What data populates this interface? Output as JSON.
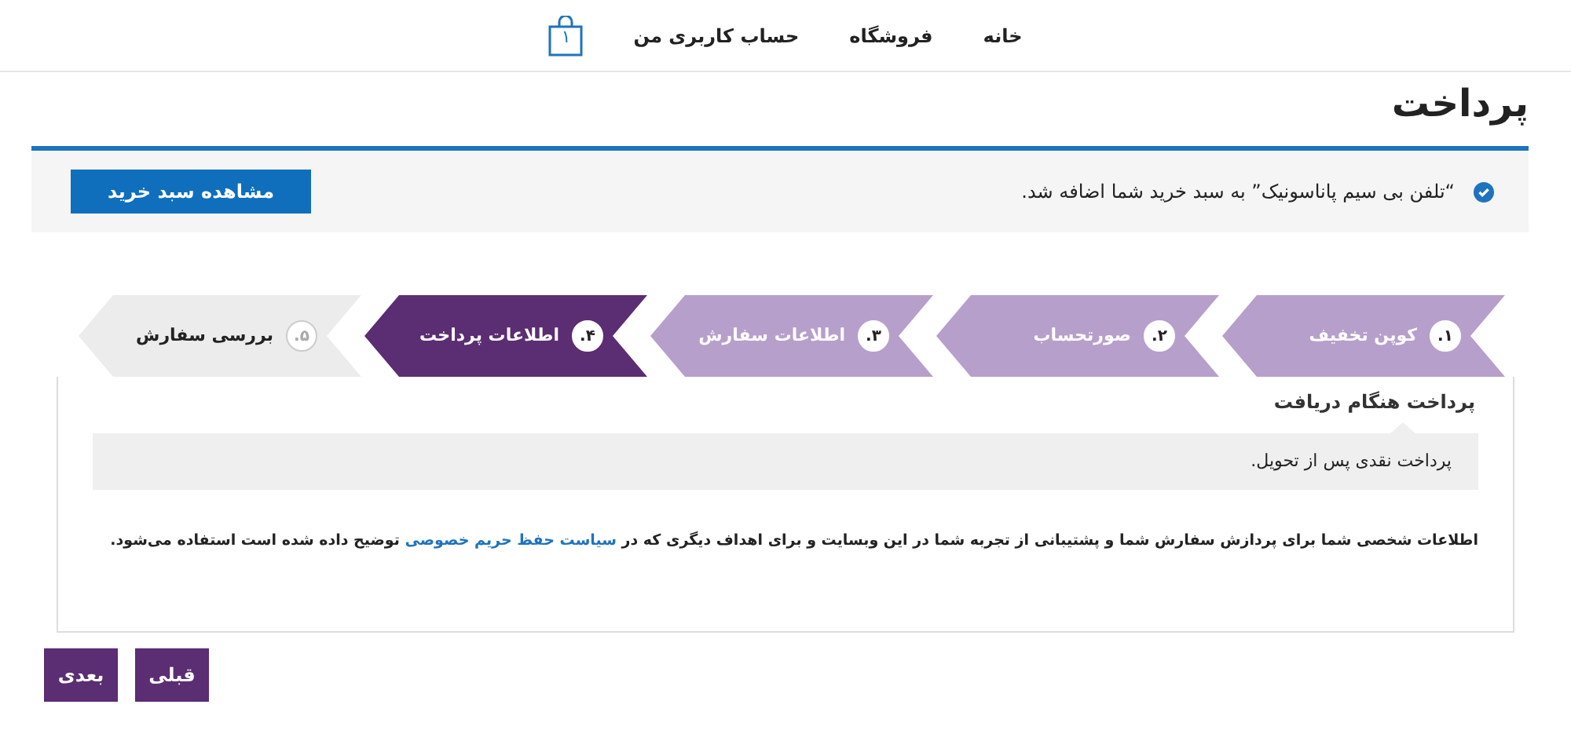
{
  "nav": {
    "items": [
      {
        "label": "خانه"
      },
      {
        "label": "فروشگاه"
      },
      {
        "label": "حساب کاربری من"
      }
    ],
    "cart_count": "۱"
  },
  "page_title": "پرداخت",
  "notice": {
    "message": "“تلفن بی سیم پاناسونیک” به سبد خرید شما اضافه شد.",
    "button": "مشاهده سبد خرید"
  },
  "steps": [
    {
      "number": "۱.",
      "label": "کوپن تخفیف",
      "selected": false
    },
    {
      "number": "۲.",
      "label": "صورتحساب",
      "selected": false
    },
    {
      "number": "۳.",
      "label": "اطلاعات سفارش",
      "selected": false
    },
    {
      "number": "۴.",
      "label": "اطلاعات پرداخت",
      "selected": true
    },
    {
      "number": "۵.",
      "label": "بررسی سفارش",
      "selected": false
    }
  ],
  "payment": {
    "method": "پرداخت هنگام دریافت",
    "description": "پرداخت نقدی پس از تحویل."
  },
  "privacy": {
    "before": "اطلاعات شخصی شما برای پردازش سفارش شما و پشتیبانی از تجربه شما در این وبسایت و برای اهداف دیگری که در ",
    "link": "سیاست حفظ حریم خصوصی",
    "after": " توضیح داده شده است استفاده می‌شود."
  },
  "buttons": [
    {
      "label": "قبلی"
    },
    {
      "label": "بعدی"
    }
  ]
}
